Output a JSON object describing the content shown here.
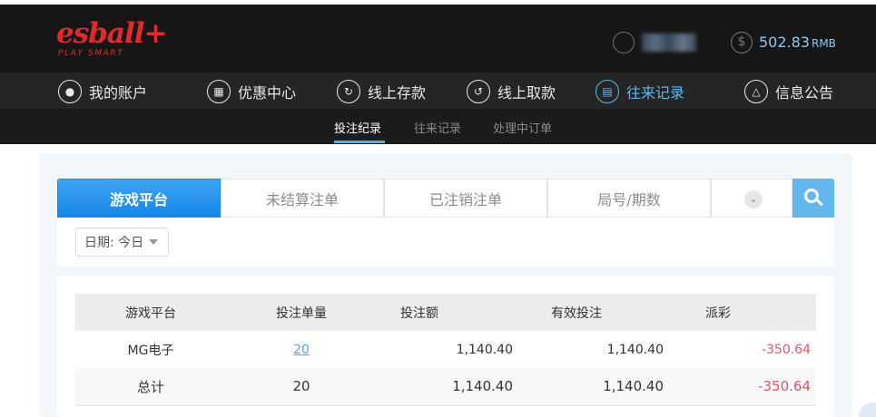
{
  "brand": {
    "name": "esball+",
    "tagline": "PLAY SMART",
    "color": "#e22a2a"
  },
  "account": {
    "balance": "502.83",
    "currency": "RMB"
  },
  "nav": {
    "items": [
      {
        "label": "我的账户",
        "icon": "user-icon"
      },
      {
        "label": "优惠中心",
        "icon": "gift-icon"
      },
      {
        "label": "线上存款",
        "icon": "deposit-icon"
      },
      {
        "label": "线上取款",
        "icon": "withdraw-icon"
      },
      {
        "label": "往来记录",
        "icon": "record-icon",
        "active": true
      },
      {
        "label": "信息公告",
        "icon": "bell-icon"
      }
    ]
  },
  "subnav": {
    "items": [
      "投注纪录",
      "往来记录",
      "处理中订单"
    ],
    "active": 0
  },
  "tabs": [
    "游戏平台",
    "未结算注单",
    "已注销注单",
    "局号/期数"
  ],
  "filter": {
    "date_label": "日期: 今日"
  },
  "table": {
    "headers": [
      "游戏平台",
      "投注单量",
      "投注额",
      "有效投注",
      "派彩"
    ],
    "rows": [
      {
        "platform": "MG电子",
        "count": "20",
        "amount": "1,140.40",
        "valid": "1,140.40",
        "payout": "-350.64"
      }
    ],
    "total": {
      "label": "总计",
      "count": "20",
      "amount": "1,140.40",
      "valid": "1,140.40",
      "payout": "-350.64"
    }
  },
  "colors": {
    "accent": "#1787e6",
    "active_nav": "#5db7ef",
    "negative": "#e0566a"
  }
}
